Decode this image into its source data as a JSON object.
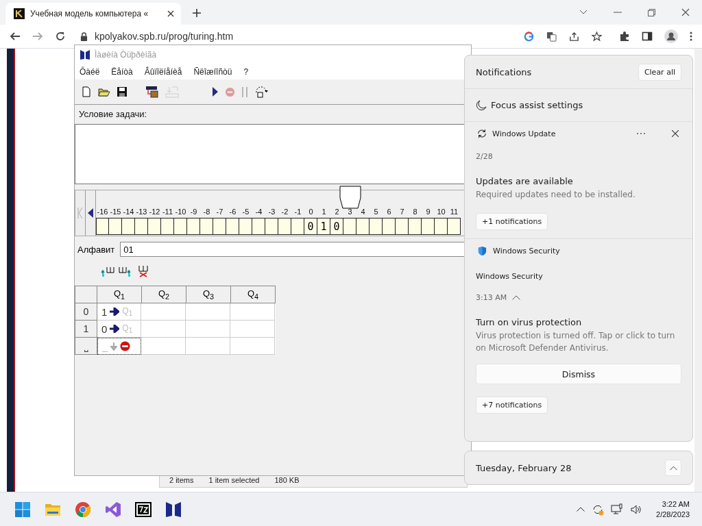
{
  "browser": {
    "tab": {
      "title": "Учебная модель компьютера «"
    },
    "url": "kpolyakov.spb.ru/prog/turing.htm"
  },
  "app": {
    "title": "Ìàøèíà Òüþðèíãà",
    "menu": [
      "Ôàéë",
      "Ëåíòà",
      "Âûïîëíåíèå",
      "Ñëîæíîñòü",
      "?"
    ],
    "toolbar": [
      {
        "kind": "new",
        "disabled": false
      },
      {
        "kind": "open",
        "disabled": false
      },
      {
        "kind": "save",
        "disabled": false
      },
      {
        "kind": "tapeload",
        "disabled": false
      },
      {
        "kind": "tapesave",
        "disabled": true
      },
      {
        "kind": "run",
        "disabled": false
      },
      {
        "kind": "stop",
        "disabled": true
      },
      {
        "kind": "pause",
        "disabled": true
      },
      {
        "kind": "step",
        "disabled": false
      }
    ],
    "task_label": "Условие задачи:",
    "tape": [
      {
        "label": "-16",
        "selected": false
      },
      {
        "label": "-15",
        "selected": false
      },
      {
        "label": "-14",
        "selected": false
      },
      {
        "label": "-13",
        "selected": false
      },
      {
        "label": "-12",
        "selected": false
      },
      {
        "label": "-11",
        "selected": false
      },
      {
        "label": "-10",
        "selected": false
      },
      {
        "label": "-9",
        "selected": false
      },
      {
        "label": "-8",
        "selected": false
      },
      {
        "label": "-7",
        "selected": false
      },
      {
        "label": "-6",
        "selected": false
      },
      {
        "label": "-5",
        "selected": false
      },
      {
        "label": "-4",
        "selected": false
      },
      {
        "label": "-3",
        "selected": false
      },
      {
        "label": "-2",
        "selected": false
      },
      {
        "label": "-1",
        "selected": false
      },
      {
        "label": "0",
        "value": "0",
        "selected": false
      },
      {
        "label": "1",
        "value": "1",
        "selected": false
      },
      {
        "label": "2",
        "value": "0",
        "selected": false
      },
      {
        "label": "3",
        "selected": true
      },
      {
        "label": "4",
        "selected": false
      },
      {
        "label": "5",
        "selected": false
      },
      {
        "label": "6",
        "selected": false
      },
      {
        "label": "7",
        "selected": false
      },
      {
        "label": "8",
        "selected": false
      },
      {
        "label": "9",
        "selected": false
      },
      {
        "label": "10",
        "selected": false
      },
      {
        "label": "11",
        "selected": false
      }
    ],
    "alphabet": {
      "label": "Алфавит",
      "value": "01"
    },
    "table": {
      "columns": [
        "Q$_{1}$",
        "Q$_{2}$",
        "Q$_{3}$",
        "Q$_{4}$"
      ],
      "rows": [
        {
          "symbol": "0",
          "cells": [
            {
              "write": "1",
              "kind": "right",
              "state": "Q$_{1}$",
              "stop": false
            },
            null,
            null,
            null
          ]
        },
        {
          "symbol": "1",
          "cells": [
            {
              "write": "0",
              "kind": "right",
              "state": "Q$_{1}$",
              "stop": false
            },
            null,
            null,
            null
          ]
        },
        {
          "symbol": "⎵",
          "cells": [
            {
              "write": "_",
              "kind": "stay",
              "stop": true
            },
            null,
            null,
            null
          ]
        }
      ]
    }
  },
  "explorer_status": [
    "2 items",
    "1 item selected",
    "180 KB"
  ],
  "notifications": {
    "title": "Notifications",
    "clear_all": "Clear all",
    "focus_assist": "Focus assist settings",
    "groups": [
      {
        "kind": "update",
        "app": "Windows Update",
        "date": "2/28",
        "expanded": false,
        "title": "Updates are available",
        "body": "Required updates need to be installed.",
        "more": "+1 notifications"
      },
      {
        "kind": "security",
        "app": "Windows Security",
        "sender": "Windows Security",
        "date": "3:13 AM",
        "expanded": true,
        "title": "Turn on virus protection",
        "body": "Virus protection is turned off. Tap or click to turn on Microsoft Defender Antivirus.",
        "action": "Dismiss",
        "more": "+7 notifications"
      }
    ],
    "calendar": {
      "date": "Tuesday, February 28",
      "expanded": false
    }
  },
  "taskbar": {
    "apps": [
      {
        "kind": "start"
      },
      {
        "kind": "folder"
      },
      {
        "kind": "chrome"
      },
      {
        "kind": "vs"
      },
      {
        "kind": "archive"
      },
      {
        "kind": "turing"
      }
    ],
    "time": "3:22 AM",
    "date": "2/28/2023"
  }
}
